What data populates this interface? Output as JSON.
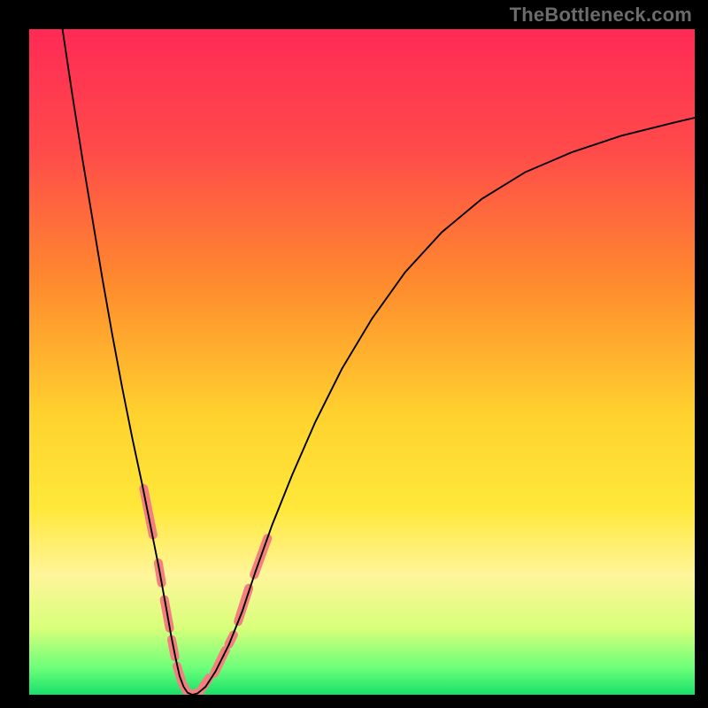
{
  "watermark": "TheBottleneck.com",
  "chart_data": {
    "type": "line",
    "title": "",
    "xlabel": "",
    "ylabel": "",
    "xlim": [
      0,
      100
    ],
    "ylim": [
      0,
      100
    ],
    "grid": false,
    "legend": false,
    "annotations": [],
    "gradient_stops": [
      {
        "offset": 0.0,
        "color": "#ff2a55"
      },
      {
        "offset": 0.18,
        "color": "#ff4a4a"
      },
      {
        "offset": 0.38,
        "color": "#ff8a2e"
      },
      {
        "offset": 0.58,
        "color": "#ffd22e"
      },
      {
        "offset": 0.72,
        "color": "#ffe83a"
      },
      {
        "offset": 0.82,
        "color": "#fff59a"
      },
      {
        "offset": 0.9,
        "color": "#d8ff7a"
      },
      {
        "offset": 0.96,
        "color": "#6cff7a"
      },
      {
        "offset": 1.0,
        "color": "#18e06a"
      }
    ],
    "series": [
      {
        "name": "bottleneck-curve",
        "stroke": "#000000",
        "stroke_width": 1.9,
        "x": [
          5.0,
          6.5,
          8.0,
          9.5,
          11.0,
          12.5,
          14.0,
          15.5,
          17.0,
          18.3,
          19.5,
          20.5,
          21.3,
          22.0,
          22.6,
          23.2,
          23.8,
          24.5,
          25.3,
          26.5,
          28.0,
          30.0,
          32.0,
          34.0,
          36.5,
          39.5,
          43.0,
          47.0,
          51.5,
          56.5,
          62.0,
          68.0,
          74.5,
          81.5,
          89.0,
          97.0,
          100.0
        ],
        "y": [
          100.0,
          90.0,
          80.5,
          71.5,
          62.5,
          54.0,
          46.0,
          38.5,
          31.5,
          25.0,
          19.0,
          13.5,
          9.0,
          5.5,
          2.8,
          1.2,
          0.3,
          0.0,
          0.2,
          1.2,
          3.5,
          7.5,
          12.5,
          18.5,
          25.5,
          33.0,
          41.0,
          49.0,
          56.5,
          63.5,
          69.5,
          74.5,
          78.5,
          81.5,
          84.0,
          86.0,
          86.7
        ]
      },
      {
        "name": "left-highlight-segments",
        "stroke": "#f47f7f",
        "stroke_width": 10,
        "linecap": "round",
        "segments": [
          {
            "x": [
              17.2,
              18.6
            ],
            "y": [
              31.0,
              24.0
            ]
          },
          {
            "x": [
              19.4,
              19.9
            ],
            "y": [
              19.8,
              16.8
            ]
          },
          {
            "x": [
              20.3,
              21.1
            ],
            "y": [
              14.3,
              10.0
            ]
          },
          {
            "x": [
              21.4,
              21.9
            ],
            "y": [
              8.3,
              5.7
            ]
          },
          {
            "x": [
              22.2,
              22.9
            ],
            "y": [
              4.3,
              2.0
            ]
          },
          {
            "x": [
              23.1,
              23.8
            ],
            "y": [
              1.5,
              0.3
            ]
          }
        ]
      },
      {
        "name": "right-highlight-segments",
        "stroke": "#f47f7f",
        "stroke_width": 10,
        "linecap": "round",
        "segments": [
          {
            "x": [
              24.6,
              25.6
            ],
            "y": [
              0.1,
              0.4
            ]
          },
          {
            "x": [
              26.0,
              27.0
            ],
            "y": [
              1.0,
              2.5
            ]
          },
          {
            "x": [
              27.8,
              29.5
            ],
            "y": [
              3.2,
              6.7
            ]
          },
          {
            "x": [
              30.0,
              30.7
            ],
            "y": [
              7.6,
              9.0
            ]
          },
          {
            "x": [
              31.4,
              33.0
            ],
            "y": [
              11.0,
              16.0
            ]
          },
          {
            "x": [
              33.8,
              35.8
            ],
            "y": [
              18.0,
              23.5
            ]
          }
        ]
      }
    ]
  }
}
